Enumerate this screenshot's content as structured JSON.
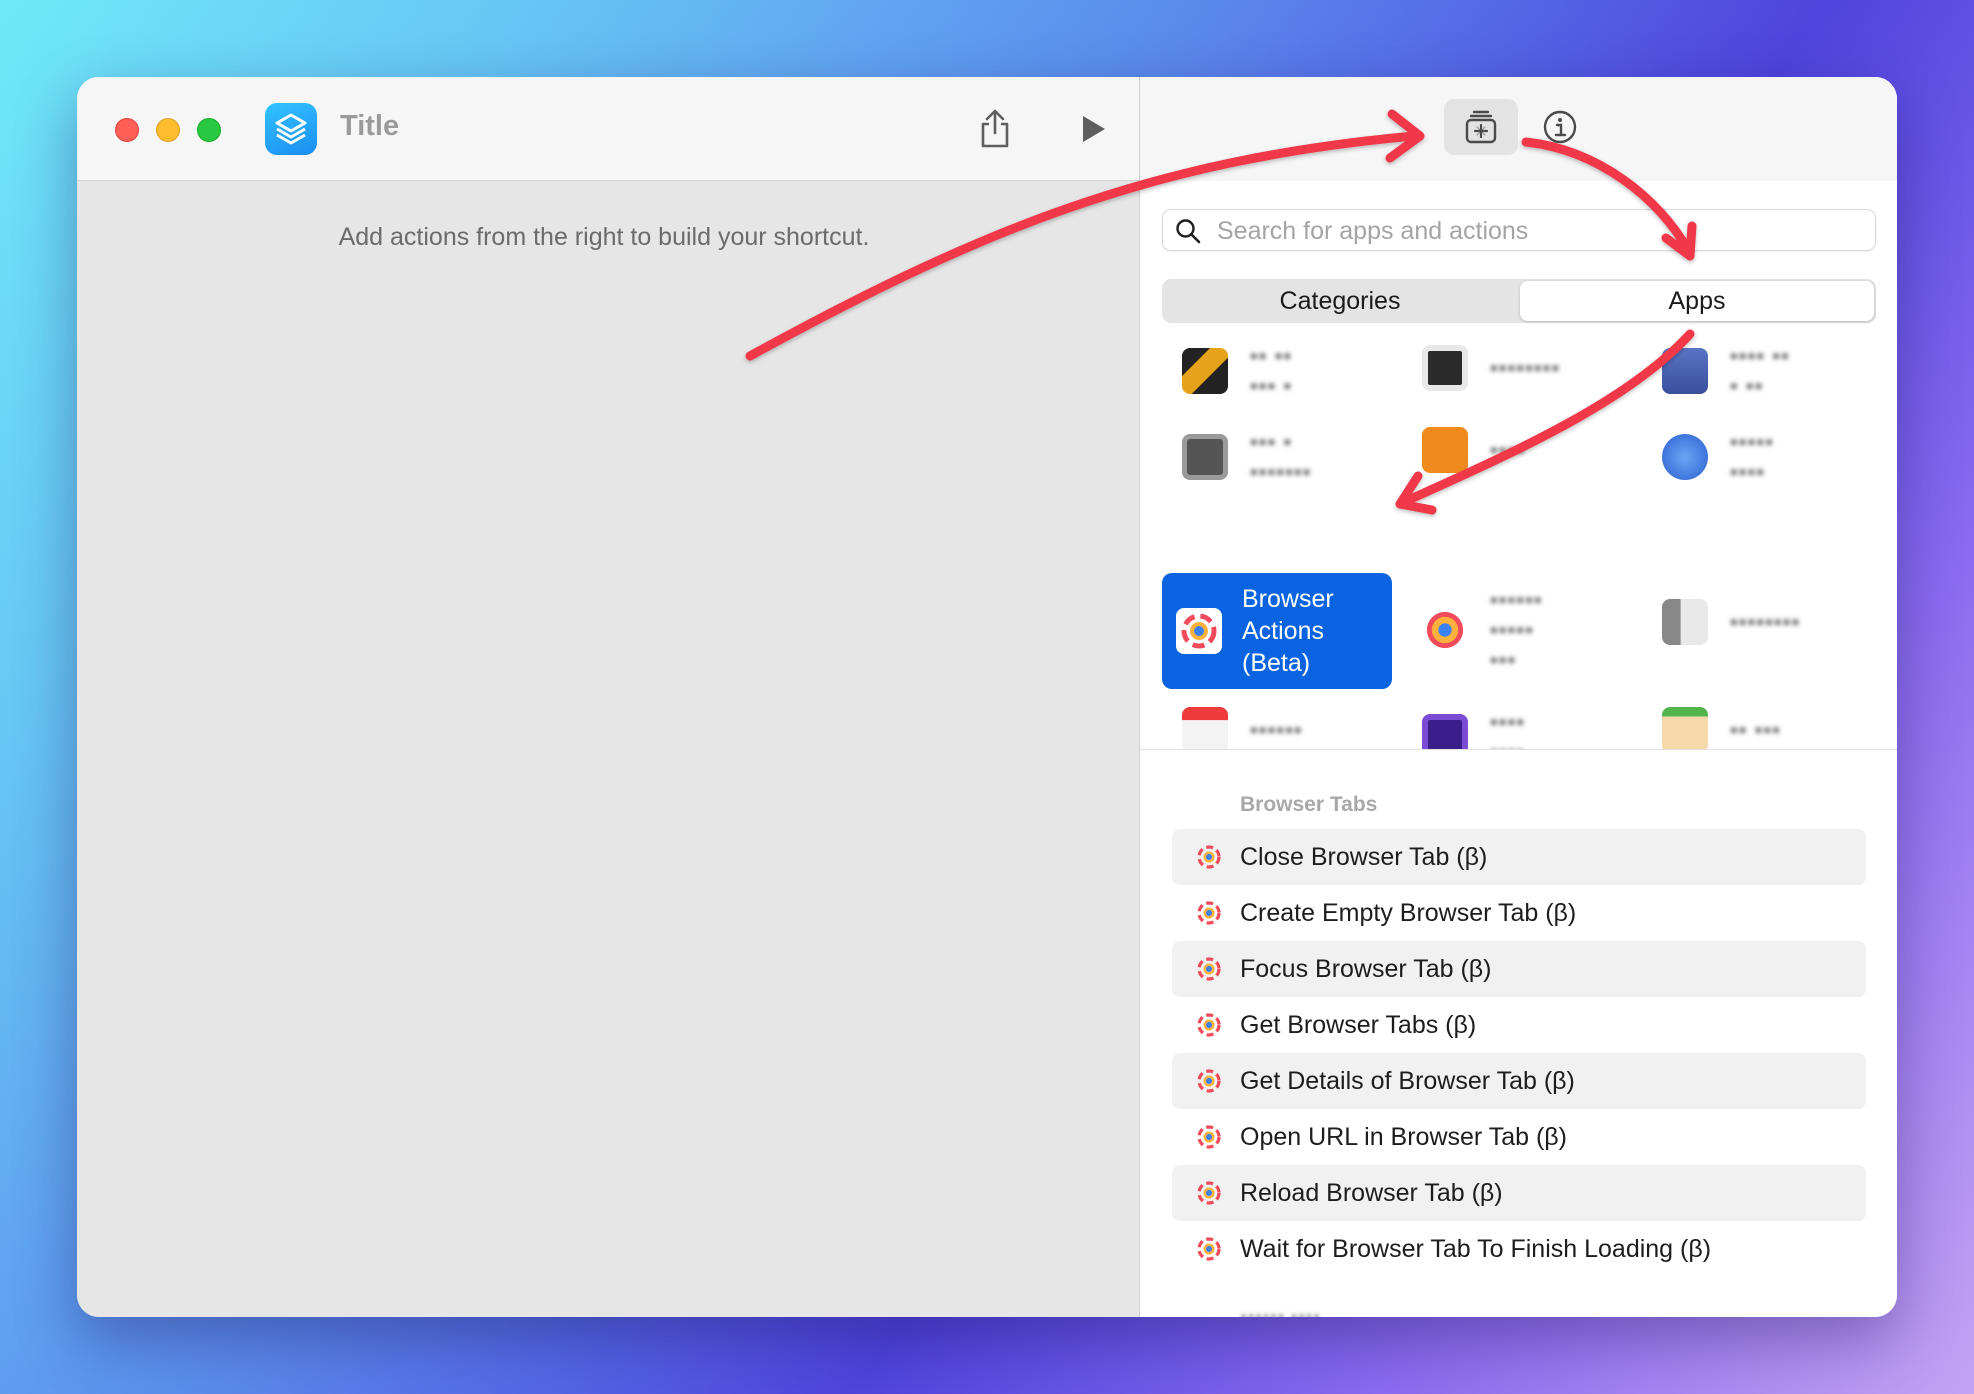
{
  "window": {
    "title": "Title",
    "hint": "Add actions from the right to build your shortcut."
  },
  "toolbar": {
    "share_icon": "share-icon",
    "run_icon": "play-icon",
    "library_icon": "action-library-icon",
    "info_icon": "info-icon"
  },
  "search": {
    "placeholder": "Search for apps and actions",
    "value": ""
  },
  "segments": {
    "categories": "Categories",
    "apps": "Apps",
    "selected": "Apps"
  },
  "selected_app": {
    "line1": "Browser",
    "line2": "Actions",
    "line3": "(Beta)"
  },
  "section": {
    "title": "Browser Tabs"
  },
  "actions": [
    {
      "label": "Close Browser Tab (β)"
    },
    {
      "label": "Create Empty Browser Tab (β)"
    },
    {
      "label": "Focus Browser Tab (β)"
    },
    {
      "label": "Get Browser Tabs (β)"
    },
    {
      "label": "Get Details of Browser Tab (β)"
    },
    {
      "label": "Open URL in Browser Tab (β)"
    },
    {
      "label": "Reload Browser Tab (β)"
    },
    {
      "label": "Wait for Browser Tab To Finish Loading (β)"
    }
  ],
  "colors": {
    "accent_selected": "#0a63e1",
    "annotation_arrow": "#f0394a",
    "app_icon": "#1a8df2"
  }
}
